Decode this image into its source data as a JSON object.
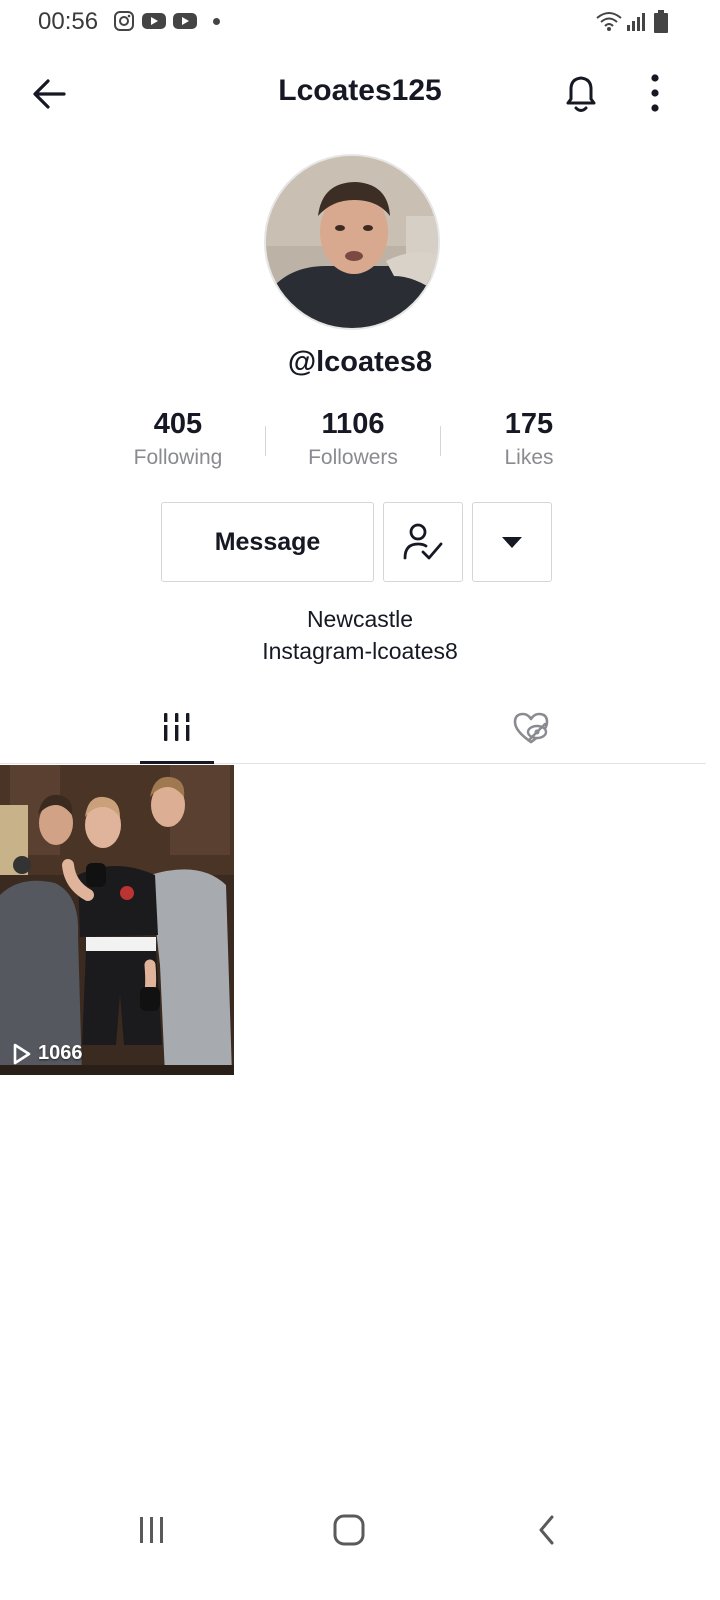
{
  "status_bar": {
    "time": "00:56",
    "notification_icons": [
      "instagram-icon",
      "youtube-icon",
      "youtube-icon"
    ],
    "system_icons": [
      "wifi-icon",
      "signal-icon",
      "battery-icon"
    ]
  },
  "header": {
    "title": "Lcoates125",
    "back_icon": "arrow-left-icon",
    "bell_icon": "bell-icon",
    "more_icon": "vertical-dots-icon"
  },
  "profile": {
    "username": "@lcoates8",
    "stats": [
      {
        "value": "405",
        "label": "Following"
      },
      {
        "value": "1106",
        "label": "Followers"
      },
      {
        "value": "175",
        "label": "Likes"
      }
    ],
    "message_label": "Message",
    "bio_lines": [
      "Newcastle",
      "Instagram-lcoates8"
    ]
  },
  "tabs": [
    {
      "id": "videos",
      "icon": "grid-icon",
      "active": true
    },
    {
      "id": "liked",
      "icon": "liked-hidden-icon",
      "active": false
    }
  ],
  "videos": [
    {
      "views": "1066"
    }
  ],
  "colors": {
    "primary_text": "#161823",
    "secondary_text": "#8a8b91",
    "border": "#d6d6d8"
  }
}
